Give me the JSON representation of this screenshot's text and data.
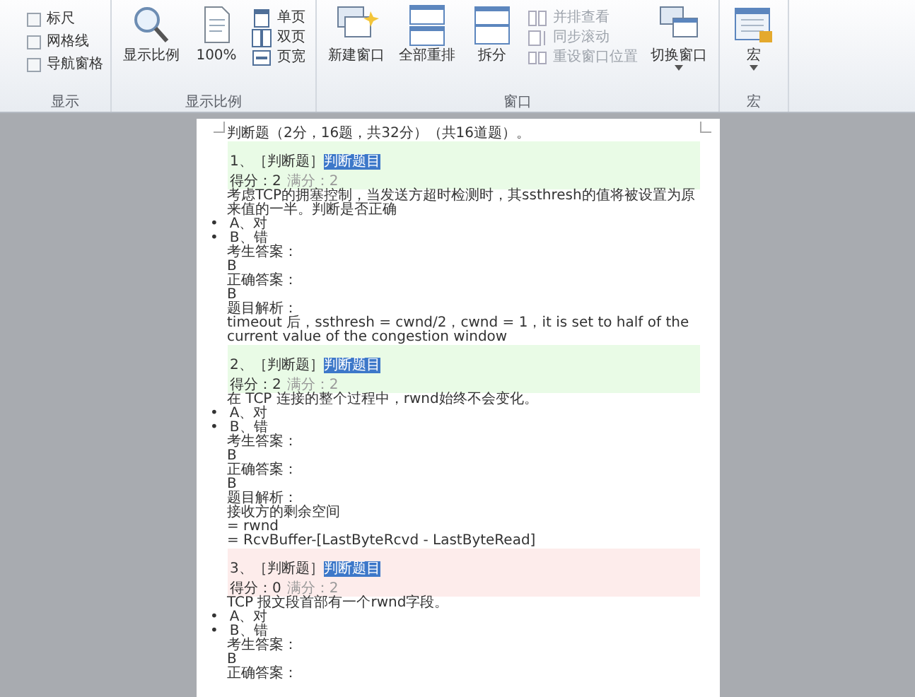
{
  "ribbon": {
    "groups": [
      {
        "label": "显示",
        "items": [
          {
            "kind": "checkbox",
            "label": "标尺",
            "checked": false
          },
          {
            "kind": "checkbox",
            "label": "网格线",
            "checked": false
          },
          {
            "kind": "checkbox",
            "label": "导航窗格",
            "checked": false
          }
        ]
      },
      {
        "label": "显示比例",
        "items": [
          {
            "kind": "large",
            "label": "显示比例",
            "dropdown": false
          },
          {
            "kind": "large",
            "label": "100%",
            "dropdown": false
          },
          {
            "kind": "small",
            "label": "单页",
            "disabled": false
          },
          {
            "kind": "small",
            "label": "双页",
            "disabled": false
          },
          {
            "kind": "small",
            "label": "页宽",
            "disabled": false
          }
        ]
      },
      {
        "label": "窗口",
        "items": [
          {
            "kind": "large",
            "label": "新建窗口",
            "dropdown": false
          },
          {
            "kind": "large",
            "label": "全部重排",
            "dropdown": false
          },
          {
            "kind": "large",
            "label": "拆分",
            "dropdown": false
          },
          {
            "kind": "small",
            "label": "并排查看",
            "disabled": true
          },
          {
            "kind": "small",
            "label": "同步滚动",
            "disabled": true
          },
          {
            "kind": "small",
            "label": "重设窗口位置",
            "disabled": true
          },
          {
            "kind": "large",
            "label": "切换窗口",
            "dropdown": true
          }
        ]
      },
      {
        "label": "宏",
        "items": [
          {
            "kind": "large",
            "label": "宏",
            "dropdown": true
          }
        ]
      }
    ]
  },
  "document": {
    "title": "判断题（2分，16题，共32分）（共16道题）。",
    "questions": [
      {
        "header": "1、［判断题］",
        "highlight": "判断题目",
        "correct": true,
        "score": "得分：2",
        "full": "满分：2",
        "stem": "考虑TCP的拥塞控制，当发送方超时检测时，其ssthresh的值将被设置为原来值的一半。判断是否正确",
        "options": [
          {
            "marker": "•",
            "text": "A、对"
          },
          {
            "marker": "•",
            "text": "B、错"
          }
        ],
        "lines": [
          "考生答案：",
          "B",
          "正确答案：",
          "B",
          "题目解析：",
          "timeout 后，ssthresh = cwnd/2，cwnd = 1，it is set to half of the current value of the congestion window"
        ]
      },
      {
        "header": "2、［判断题］",
        "highlight": "判断题目",
        "correct": true,
        "score": "得分：2",
        "full": "满分：2",
        "stem": "在 TCP 连接的整个过程中，rwnd始终不会变化。",
        "options": [
          {
            "marker": "•",
            "text": "A、对"
          },
          {
            "marker": "•",
            "text": "B、错"
          }
        ],
        "lines": [
          "考生答案：",
          "B",
          "正确答案：",
          "B",
          "题目解析：",
          "接收方的剩余空间",
          "= rwnd",
          "= RcvBuffer-[LastByteRcvd - LastByteRead]"
        ]
      },
      {
        "header": "3、［判断题］",
        "highlight": "判断题目",
        "correct": false,
        "score": "得分：0",
        "full": "满分：2",
        "stem": "TCP 报文段首部有一个rwnd字段。",
        "options": [
          {
            "marker": "•",
            "text": "A、对"
          },
          {
            "marker": "•",
            "text": "B、错"
          }
        ],
        "lines": [
          "考生答案：",
          "B",
          "正确答案："
        ]
      }
    ]
  }
}
